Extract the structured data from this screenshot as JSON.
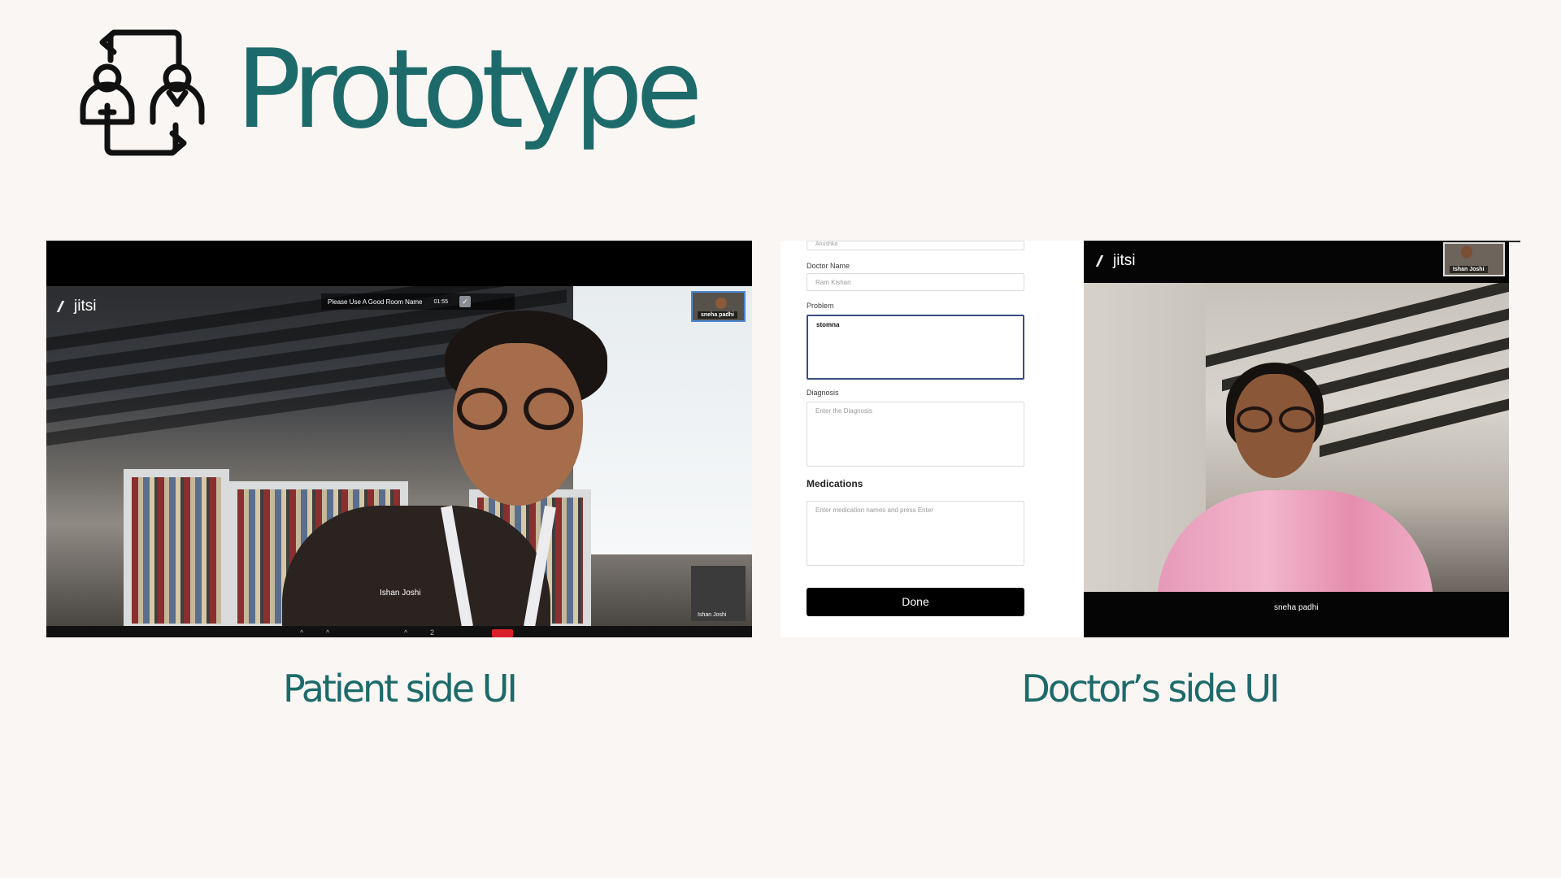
{
  "header": {
    "title": "Prototype"
  },
  "captions": {
    "patient": "Patient side UI",
    "doctor": "Doctor’s side UI"
  },
  "patient_ui": {
    "logo": "jitsi",
    "room_prompt": "Please Use A Good Room Name",
    "timer": "01:55",
    "main_participant": "Ishan Joshi",
    "thumb_remote": "sneha padhi",
    "thumb_local": "Ishan Joshi",
    "toolbar_count": "2"
  },
  "doctor_ui": {
    "form": {
      "patient_name_value": "Anushka",
      "doctor_name_label": "Doctor Name",
      "doctor_name_value": "Ram Kishan",
      "problem_label": "Problem",
      "problem_value": "stomna",
      "diagnosis_label": "Diagnosis",
      "diagnosis_placeholder": "Enter the Diagnosis",
      "medications_label": "Medications",
      "medications_placeholder": "Enter medication names and press Enter",
      "done_label": "Done"
    },
    "video": {
      "logo": "jitsi",
      "main_participant": "sneha padhi",
      "thumb_participant": "Ishan Joshi"
    }
  },
  "colors": {
    "title_teal": "#1d6a6a",
    "background": "#faf6f3",
    "hangup_red": "#d9202a"
  },
  "icons": {
    "header_icon": "doctor-patient-exchange-icon"
  }
}
